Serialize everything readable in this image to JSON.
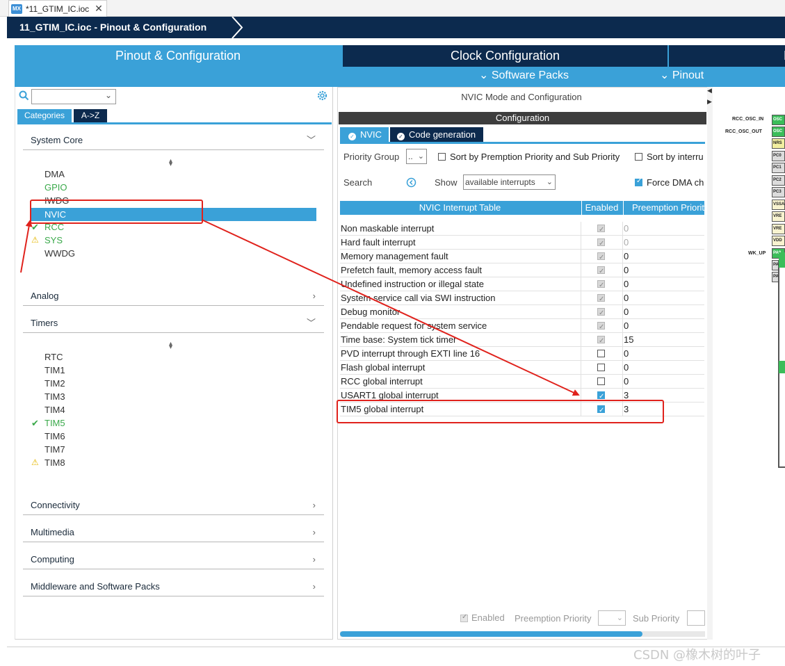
{
  "editor_tab": {
    "icon": "MX",
    "title": "*11_GTIM_IC.ioc",
    "close": "✕"
  },
  "breadcrumb": {
    "title": "11_GTIM_IC.ioc - Pinout & Configuration"
  },
  "main_tabs": {
    "pinout": "Pinout & Configuration",
    "clock": "Clock Configuration",
    "next": "P",
    "software_packs": "Software Packs",
    "pinout_menu": "Pinout"
  },
  "left": {
    "search_placeholder": "",
    "tabs": {
      "categories": "Categories",
      "az": "A->Z"
    },
    "system_core": "System Core",
    "system_core_items": [
      "DMA",
      "GPIO",
      "IWDG",
      "NVIC",
      "RCC",
      "SYS",
      "WWDG"
    ],
    "analog": "Analog",
    "timers": "Timers",
    "timer_items": [
      "RTC",
      "TIM1",
      "TIM2",
      "TIM3",
      "TIM4",
      "TIM5",
      "TIM6",
      "TIM7",
      "TIM8"
    ],
    "connectivity": "Connectivity",
    "multimedia": "Multimedia",
    "computing": "Computing",
    "middleware": "Middleware and Software Packs"
  },
  "mid": {
    "mode_title": "NVIC Mode and Configuration",
    "configuration": "Configuration",
    "tab_nvic": "NVIC",
    "tab_code": "Code generation",
    "priority_group_label": "Priority Group",
    "priority_group_value": "..",
    "sort_preemption": "Sort by Premption Priority and Sub Priority",
    "sort_interrupts": "Sort by interru",
    "search_label": "Search",
    "show_label": "Show",
    "show_value": "available interrupts",
    "force_dma": "Force DMA ch",
    "table_headers": [
      "NVIC Interrupt Table",
      "Enabled",
      "Preemption Priorit"
    ],
    "rows": [
      {
        "name": "Non maskable interrupt",
        "enabled": "locked",
        "priority": "0"
      },
      {
        "name": "Hard fault interrupt",
        "enabled": "locked",
        "priority": "0"
      },
      {
        "name": "Memory management fault",
        "enabled": "locked",
        "priority": "0"
      },
      {
        "name": "Prefetch fault, memory access fault",
        "enabled": "locked",
        "priority": "0"
      },
      {
        "name": "Undefined instruction or illegal state",
        "enabled": "locked",
        "priority": "0"
      },
      {
        "name": "System service call via SWI instruction",
        "enabled": "locked",
        "priority": "0"
      },
      {
        "name": "Debug monitor",
        "enabled": "locked",
        "priority": "0"
      },
      {
        "name": "Pendable request for system service",
        "enabled": "locked",
        "priority": "0"
      },
      {
        "name": "Time base: System tick timer",
        "enabled": "locked",
        "priority": "15"
      },
      {
        "name": "PVD interrupt through EXTI line 16",
        "enabled": "off",
        "priority": "0"
      },
      {
        "name": "Flash global interrupt",
        "enabled": "off",
        "priority": "0"
      },
      {
        "name": "RCC global interrupt",
        "enabled": "off",
        "priority": "0"
      },
      {
        "name": "USART1 global interrupt",
        "enabled": "on",
        "priority": "3"
      },
      {
        "name": "TIM5 global interrupt",
        "enabled": "on",
        "priority": "3"
      }
    ],
    "bottom_enabled": "Enabled",
    "bottom_preemption": "Preemption Priority",
    "bottom_sub": "Sub Priority"
  },
  "chip": {
    "labels": [
      "RCC_OSC_IN",
      "RCC_OSC_OUT",
      "WK_UP"
    ],
    "pins": [
      "OSC",
      "OSC",
      "NRS",
      "PC0",
      "PC1",
      "PC2",
      "PC3",
      "VSSA",
      "VRE",
      "VRE",
      "VDD",
      "PA0",
      "PA",
      "PA"
    ]
  },
  "watermark": "CSDN @橡木树的叶子",
  "colors": {
    "accent": "#3aa1d8",
    "navy": "#0c2a4e",
    "annotation": "#e0221c",
    "ok_green": "#3aa94a",
    "warn_yellow": "#e5b700"
  }
}
